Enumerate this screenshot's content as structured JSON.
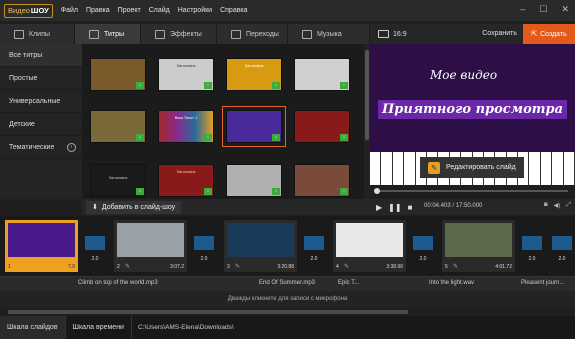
{
  "app": {
    "logo_a": "ВидеоШОУ",
    "logo_b": "ШОУ"
  },
  "menu": [
    "Файл",
    "Правка",
    "Проект",
    "Слайд",
    "Настройки",
    "Справка"
  ],
  "tabs": [
    {
      "label": "Клипы",
      "active": false
    },
    {
      "label": "Титры",
      "active": true
    },
    {
      "label": "Эффекты",
      "active": false
    },
    {
      "label": "Переходы",
      "active": false
    },
    {
      "label": "Музыка",
      "active": false
    }
  ],
  "toolbar": {
    "ratio": "16:9",
    "save": "Сохранить",
    "create": "Создать"
  },
  "sidebar": [
    {
      "label": "Все титры"
    },
    {
      "label": "Простые"
    },
    {
      "label": "Универсальные"
    },
    {
      "label": "Детские"
    },
    {
      "label": "Тематические"
    }
  ],
  "thumbs": [
    {
      "color": "#7a5a2a",
      "text": ""
    },
    {
      "color": "#cccccc",
      "text": "Заголовок"
    },
    {
      "color": "#d89a10",
      "text": "Заголовок"
    },
    {
      "color": "#d0d0d0",
      "text": ""
    },
    {
      "color": "#7a6a3a",
      "text": ""
    },
    {
      "color": "#8a2a8a",
      "text": "Ваш Текст 1"
    },
    {
      "color": "#4a2a9a",
      "text": ""
    },
    {
      "color": "#8a1a1a",
      "text": ""
    },
    {
      "color": "#1a1a1a",
      "text": "Заголовок"
    },
    {
      "color": "#8a1a1a",
      "text": "Заголовок"
    },
    {
      "color": "#b0b0b0",
      "text": ""
    },
    {
      "color": "#7a4a3a",
      "text": ""
    }
  ],
  "preview": {
    "line1": "Мое видео",
    "line2": "Приятного просмотра",
    "edit": "Редактировать слайд"
  },
  "player": {
    "time": "00:04.403 / 17:50.000"
  },
  "add_label": "Добавить в слайд-шоу",
  "clips": [
    {
      "num": "1",
      "dur": "7.0",
      "color": "#4a1a8a"
    },
    {
      "num": "2",
      "dur": "3:07.2",
      "color": "#9aa0a8"
    },
    {
      "num": "3",
      "dur": "3:20.88",
      "color": "#1a3a5a"
    },
    {
      "num": "4",
      "dur": "3:38.96",
      "color": "#e8e8e8"
    },
    {
      "num": "5",
      "dur": "4:01.72",
      "color": "#5a6a4a"
    }
  ],
  "transitions": [
    "2.0",
    "2.0",
    "2.0",
    "2.0",
    "2.0",
    "2.0"
  ],
  "audio": [
    "Climb on top of the world.mp3",
    "End Of Summer.mp3",
    "Epic T...",
    "Into the light.wav",
    "Pleasent journ..."
  ],
  "mic_hint": "Дважды кликните для записи с микрофона",
  "bottom": {
    "tab1": "Шкала слайдов",
    "tab2": "Шкала времени",
    "path": "C:\\Users\\AMS-Elena\\Downloads\\"
  }
}
